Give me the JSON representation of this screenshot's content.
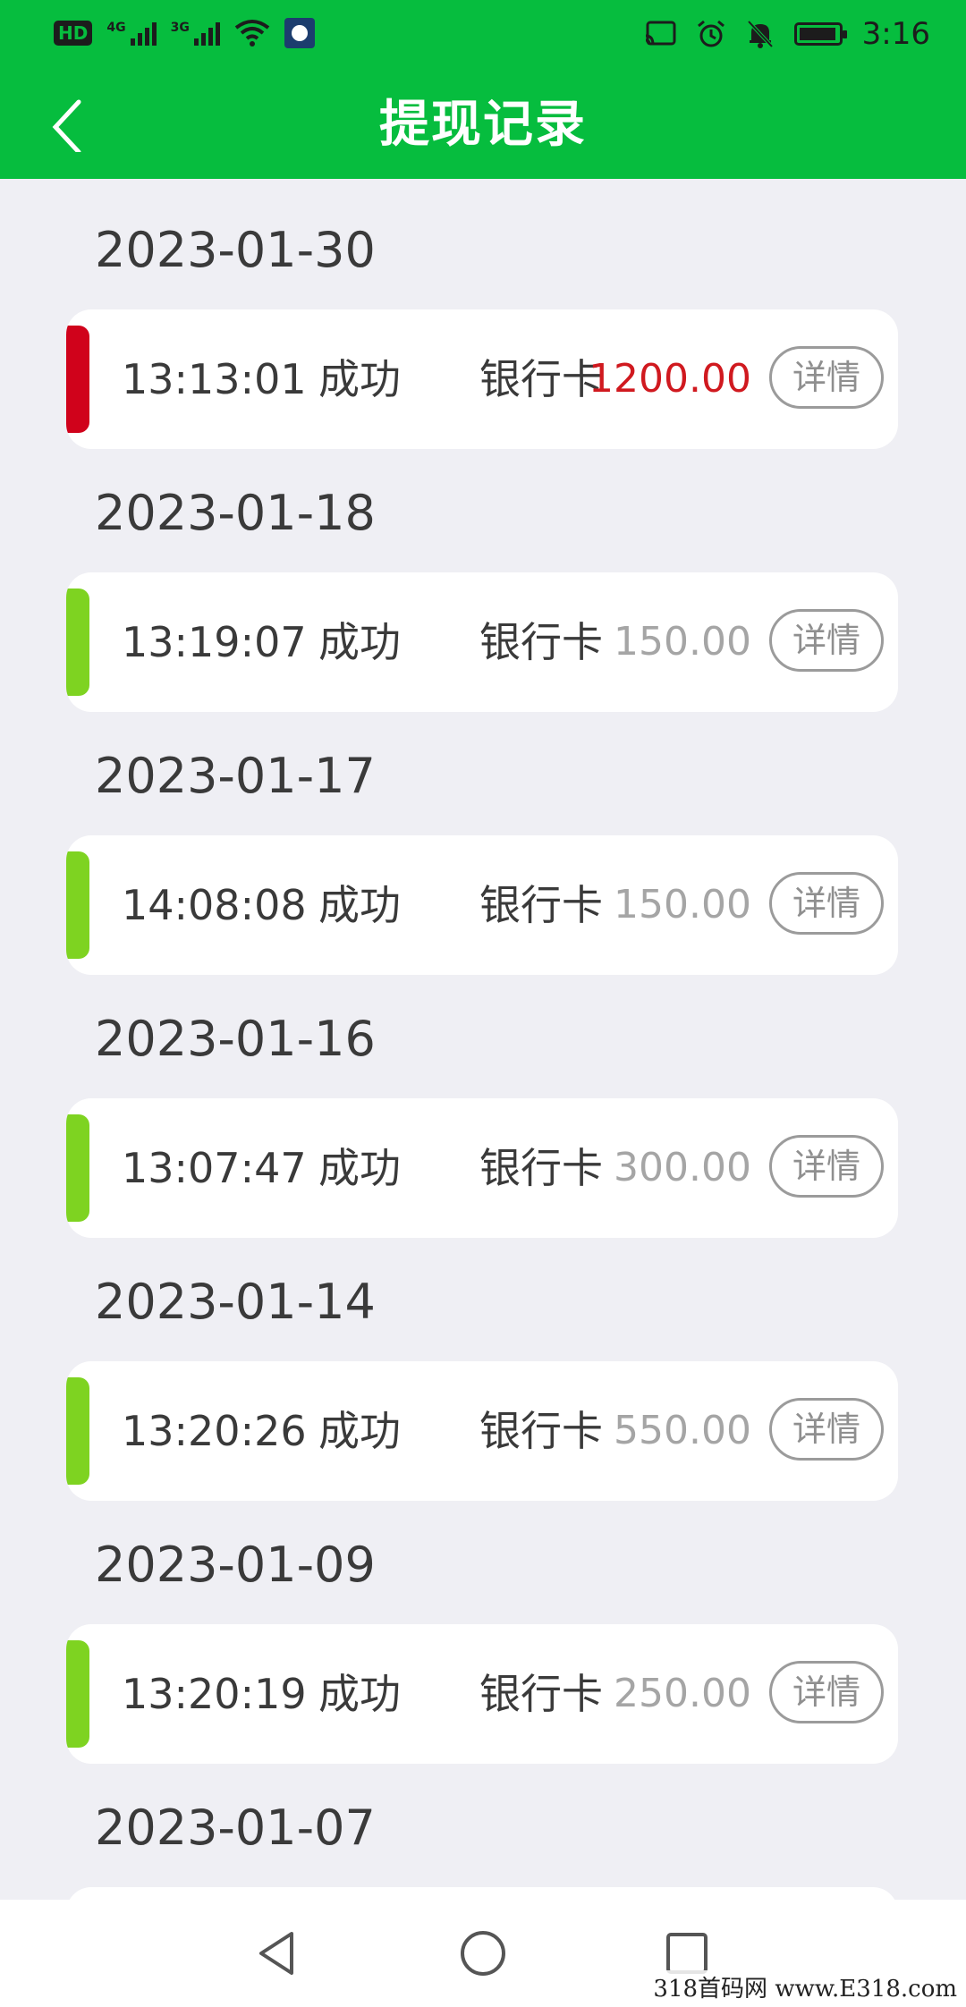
{
  "status_bar": {
    "left_icons": [
      "hd-icon",
      "volte-icon",
      "signal-4g-icon",
      "signal-3g-icon",
      "wifi-icon",
      "app-notification-icon"
    ],
    "hd_label": "HD",
    "sig1_label": "4G",
    "sig2_label": "3G",
    "right_icons": [
      "cast-icon",
      "alarm-icon",
      "mute-icon",
      "battery-icon"
    ],
    "time": "3:16"
  },
  "header": {
    "title": "提现记录",
    "background": "#06BD3E"
  },
  "colors": {
    "accent_green": "#06BD3E",
    "bar_green": "#7ED321",
    "bar_red": "#D0021B",
    "amount_red": "#D0191F",
    "amount_gray": "#A5A5A5"
  },
  "records": [
    {
      "date": "2023-01-30",
      "time": "13:13:01",
      "status": "成功",
      "method": "银行卡",
      "amount": "1200.00",
      "highlight": true,
      "detail": "详情"
    },
    {
      "date": "2023-01-18",
      "time": "13:19:07",
      "status": "成功",
      "method": "银行卡",
      "amount": "150.00",
      "highlight": false,
      "detail": "详情"
    },
    {
      "date": "2023-01-17",
      "time": "14:08:08",
      "status": "成功",
      "method": "银行卡",
      "amount": "150.00",
      "highlight": false,
      "detail": "详情"
    },
    {
      "date": "2023-01-16",
      "time": "13:07:47",
      "status": "成功",
      "method": "银行卡",
      "amount": "300.00",
      "highlight": false,
      "detail": "详情"
    },
    {
      "date": "2023-01-14",
      "time": "13:20:26",
      "status": "成功",
      "method": "银行卡",
      "amount": "550.00",
      "highlight": false,
      "detail": "详情"
    },
    {
      "date": "2023-01-09",
      "time": "13:20:19",
      "status": "成功",
      "method": "银行卡",
      "amount": "250.00",
      "highlight": false,
      "detail": "详情"
    },
    {
      "date": "2023-01-07",
      "time": "",
      "status": "",
      "method": "",
      "amount": "",
      "highlight": false,
      "detail": ""
    }
  ],
  "nav_bar": {
    "buttons": [
      "back-triangle-icon",
      "home-circle-icon",
      "recents-square-icon"
    ]
  },
  "watermark": "318首码网 www.E318.com"
}
